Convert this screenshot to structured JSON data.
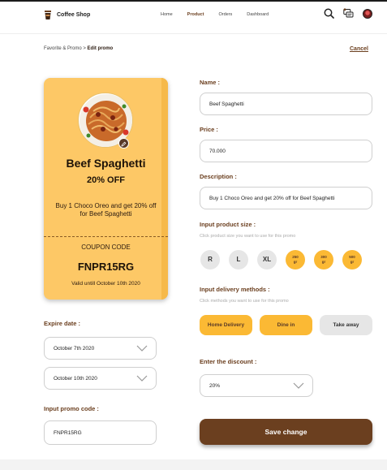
{
  "header": {
    "app_name": "Coffee Shop",
    "nav": [
      "Home",
      "Product",
      "Orders",
      "Dashboard"
    ],
    "active_nav": "Product"
  },
  "breadcrumb": {
    "parent": "Favorite & Promo",
    "separator": " > ",
    "current": "Edit promo"
  },
  "cancel_label": "Cancel",
  "coupon": {
    "title": "Beef Spaghetti",
    "discount_text": "20% OFF",
    "description": "Buy 1 Choco Oreo and get 20% off for Beef Spaghetti",
    "code_label": "COUPON CODE",
    "code": "FNPR15RG",
    "valid_text": "Valid untill October 10th 2020",
    "card_color": "#fdc866"
  },
  "expire": {
    "label": "Expire date :",
    "start": "October 7th 2020",
    "end": "October 10th 2020"
  },
  "promo_code": {
    "label": "Input promo code :",
    "value": "FNPR15RG"
  },
  "form": {
    "name_label": "Name :",
    "name_value": "Beef Spaghetti",
    "price_label": "Price :",
    "price_value": "70.000",
    "description_label": "Description :",
    "description_value": "Buy 1 Choco Oreo and get 20% off for Beef Spaghetti",
    "size_label": "Input product size :",
    "size_hint": "Click product size you want to use for this promo",
    "sizes": [
      {
        "label": "R",
        "selected": false
      },
      {
        "label": "L",
        "selected": false
      },
      {
        "label": "XL",
        "selected": false
      },
      {
        "label": "250 gr",
        "selected": true
      },
      {
        "label": "300 gr",
        "selected": true
      },
      {
        "label": "500 gr",
        "selected": true
      }
    ],
    "delivery_label": "Input delivery methods :",
    "delivery_hint": "Click methods you want to use for this promo",
    "delivery": [
      {
        "label": "Home Delivery",
        "selected": true
      },
      {
        "label": "Dine in",
        "selected": true
      },
      {
        "label": "Take away",
        "selected": false
      }
    ],
    "discount_label": "Enter the discount :",
    "discount_value": "20%",
    "save_label": "Save change"
  },
  "colors": {
    "brand_brown": "#6b3f1f",
    "accent_yellow": "#fbb934",
    "chip_grey": "#e6e6e6"
  }
}
